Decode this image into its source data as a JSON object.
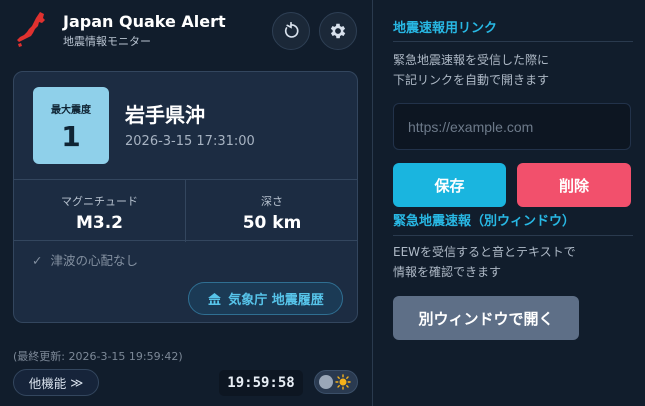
{
  "app": {
    "title": "Japan Quake Alert",
    "subtitle": "地震情報モニター"
  },
  "quake": {
    "intensity_label": "最大震度",
    "intensity_value": "1",
    "location": "岩手県沖",
    "datetime": "2026-3-15 17:31:00",
    "magnitude_label": "マグニチュード",
    "magnitude_value": "M3.2",
    "depth_label": "深さ",
    "depth_value": "50 km",
    "tsunami_check": "✓",
    "tsunami_text": "津波の心配なし",
    "jma_button_label": "気象庁 地震履歴"
  },
  "footer": {
    "last_update": "(最終更新: 2026-3-15 19:59:42)",
    "more_label": "他機能",
    "more_chevron": "≫",
    "clock": "19:59:58"
  },
  "settings": {
    "section_title": "地震速報用リンク",
    "description_line1": "緊急地震速報を受信した際に",
    "description_line2": "下記リンクを自動で開きます",
    "url_placeholder": "https://example.com",
    "save_label": "保存",
    "delete_label": "削除",
    "eew_link_label": "緊急地震速報（別ウィンドウ）",
    "eew_desc_line1": "EEWを受信すると音とテキストで",
    "eew_desc_line2": "情報を確認できます",
    "open_window_label": "別ウィンドウで開く"
  },
  "colors": {
    "accent": "#28b8e4",
    "intensity_1": "#8fd0ea",
    "save": "#1ab5df",
    "delete": "#f2506c",
    "logo_red": "#e0312f"
  },
  "icons": {
    "logo": "japan-map-logo",
    "refresh": "refresh-icon",
    "settings": "gear-icon",
    "jma": "building-icon",
    "theme": "sun-icon"
  }
}
